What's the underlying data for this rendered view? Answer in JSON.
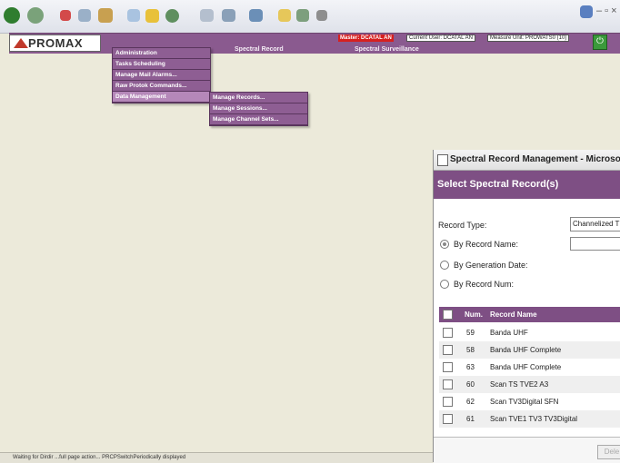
{
  "app": {
    "logo_text": "PROMAX",
    "nav": [
      "Spectral Record",
      "Spectral Surveillance"
    ],
    "status": {
      "master": "Master: DCATAL AN",
      "current_user": "Current User: DCATAL AN",
      "measure_unit": "Measure Unit: PROWATS0 (10)"
    }
  },
  "menu": {
    "level1": [
      "Administration",
      "Tasks Scheduling",
      "Manage Mail Alarms...",
      "Raw Protok Commands...",
      "Data Management"
    ],
    "level2": [
      "Manage Records...",
      "Manage Sessions...",
      "Manage Channel Sets..."
    ]
  },
  "dialog": {
    "window_title": "Spectral Record Management - Microsoft",
    "header": "Select Spectral Record(s)",
    "record_type_label": "Record Type:",
    "record_type_value": "Channelized T",
    "by_name": "By Record Name:",
    "by_date": "By Generation Date:",
    "by_num": "By Record Num:",
    "columns": [
      "Num.",
      "Record Name"
    ],
    "rows": [
      {
        "num": "59",
        "name": "Banda UHF"
      },
      {
        "num": "58",
        "name": "Banda UHF Complete"
      },
      {
        "num": "63",
        "name": "Banda UHF Complete"
      },
      {
        "num": "60",
        "name": "Scan TS TVE2 A3"
      },
      {
        "num": "62",
        "name": "Scan TV3Digital SFN"
      },
      {
        "num": "61",
        "name": "Scan TVE1 TV3 TV3Digital"
      }
    ],
    "delete_button": "Dele"
  },
  "statusbar": {
    "text": "Waiting for Dirdir ...full page action... PRCPSwitchPeriodically displayed"
  }
}
